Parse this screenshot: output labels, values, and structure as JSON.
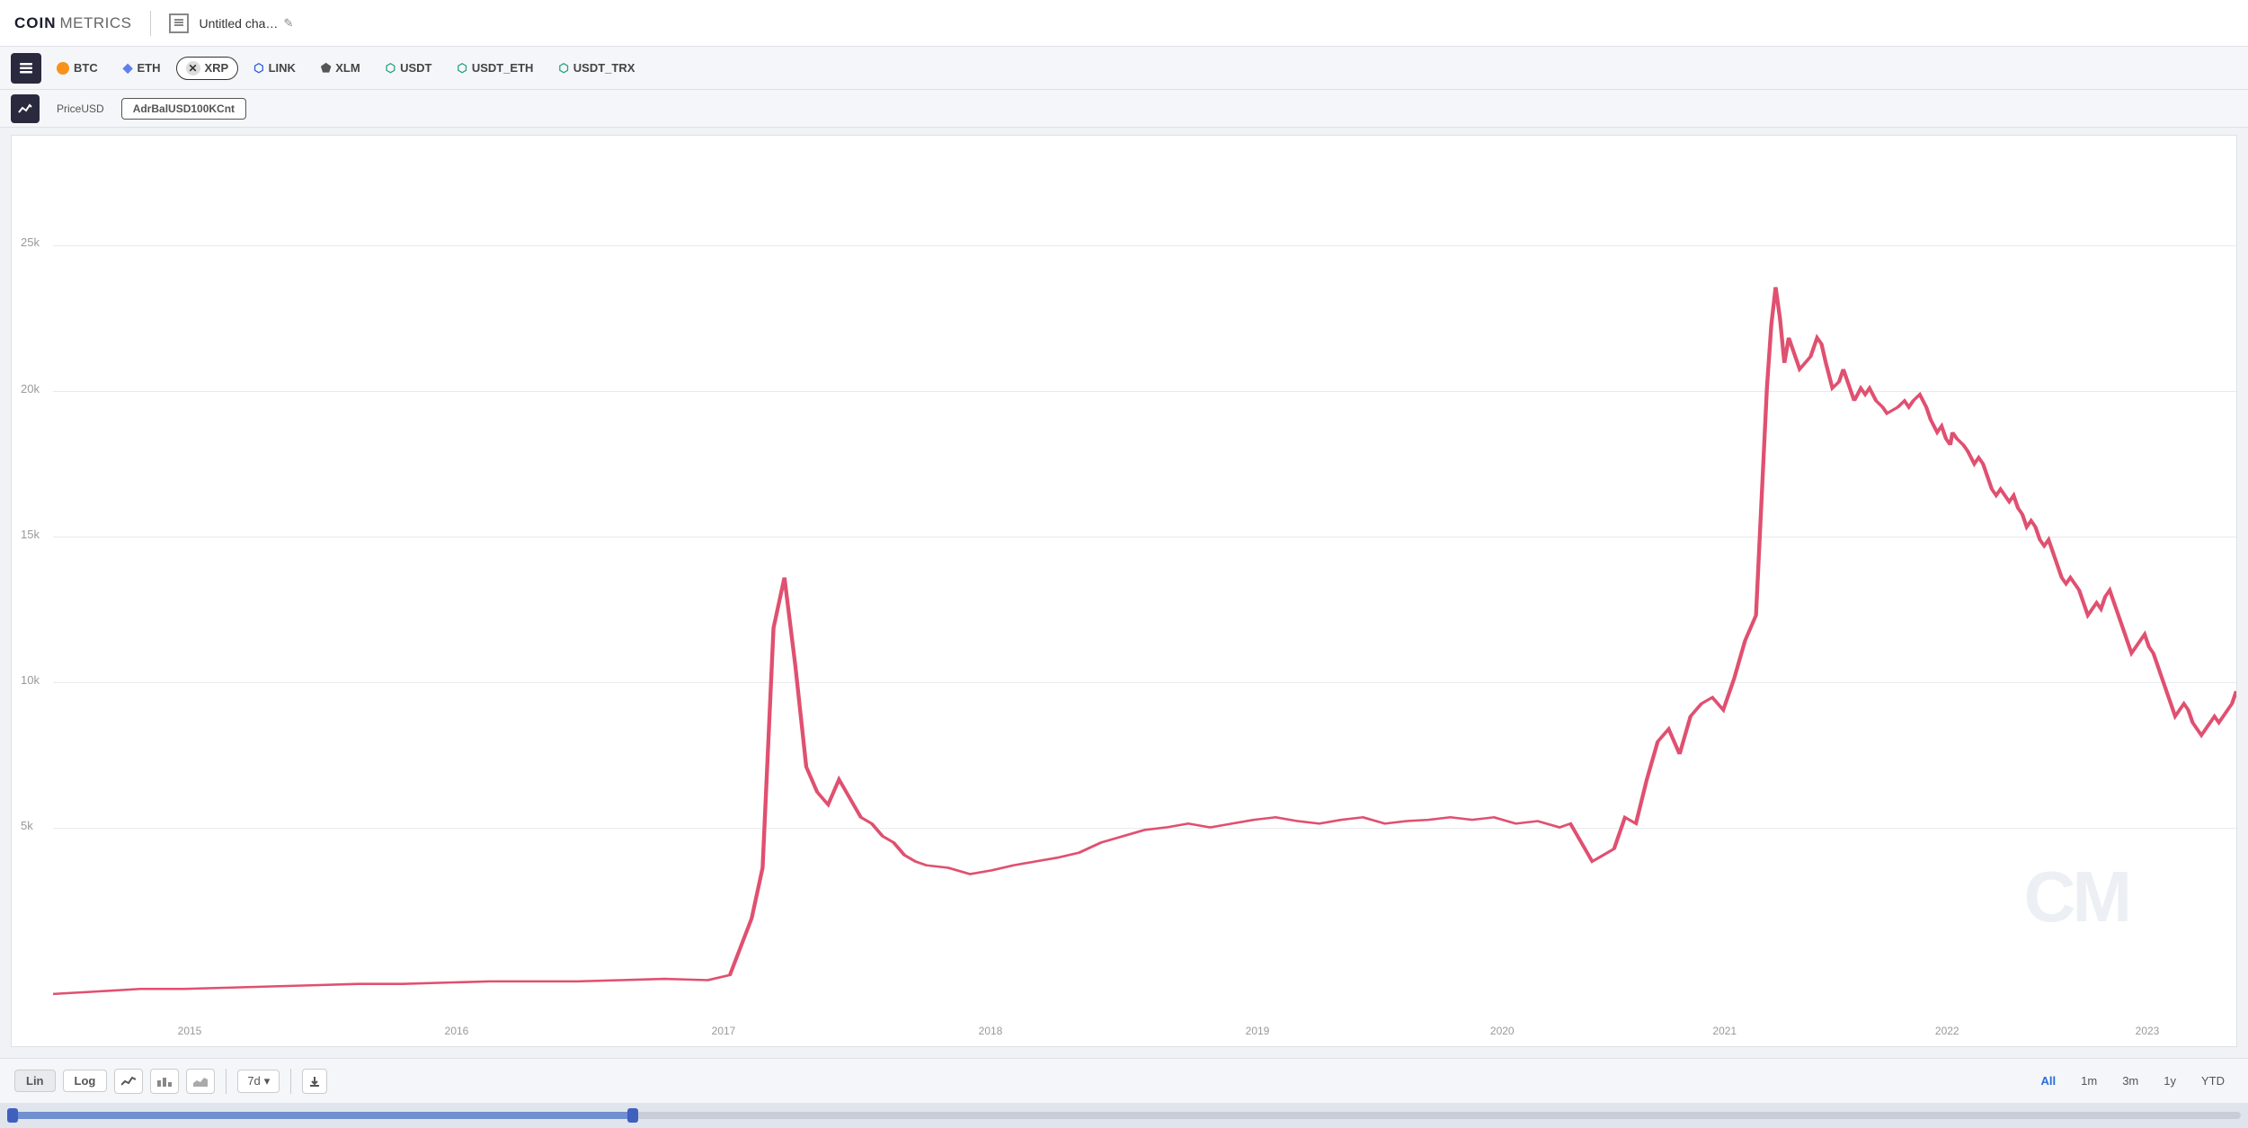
{
  "header": {
    "logo_coin": "COIN",
    "logo_metrics": "METRICS",
    "chart_title": "Untitled cha…",
    "edit_label": "✎"
  },
  "toolbar": {
    "coins": [
      {
        "id": "BTC",
        "label": "BTC",
        "color": "#f7931a",
        "type": "circle",
        "active": false
      },
      {
        "id": "ETH",
        "label": "ETH",
        "color": "#627eea",
        "type": "circle",
        "active": false
      },
      {
        "id": "XRP",
        "label": "XRP",
        "color": "#333",
        "type": "x",
        "active": true
      },
      {
        "id": "LINK",
        "label": "LINK",
        "color": "#2a5ada",
        "type": "circle",
        "active": false
      },
      {
        "id": "XLM",
        "label": "XLM",
        "color": "#666",
        "type": "shield",
        "active": false
      },
      {
        "id": "USDT",
        "label": "USDT",
        "color": "#26a17b",
        "type": "shield",
        "active": false
      },
      {
        "id": "USDT_ETH",
        "label": "USDT_ETH",
        "color": "#26a17b",
        "type": "shield",
        "active": false
      },
      {
        "id": "USDT_TRX",
        "label": "USDT_TRX",
        "color": "#26a17b",
        "type": "shield",
        "active": false
      }
    ]
  },
  "metric_toolbar": {
    "metrics": [
      {
        "id": "PriceUSD",
        "label": "PriceUSD",
        "active": false
      },
      {
        "id": "AdrBalUSD100KCnt",
        "label": "AdrBalUSD100KCnt",
        "active": true
      }
    ]
  },
  "chart": {
    "y_labels": [
      "25k",
      "20k",
      "15k",
      "10k",
      "5k"
    ],
    "x_labels": [
      "2015",
      "2016",
      "2017",
      "2018",
      "2019",
      "2020",
      "2021",
      "2022",
      "2023"
    ],
    "watermark": "CM",
    "line_color": "#e05070"
  },
  "bottom_controls": {
    "scale_lin": "Lin",
    "scale_log": "Log",
    "interval": "7d",
    "ranges": [
      "All",
      "1m",
      "3m",
      "1y",
      "YTD"
    ],
    "active_range": "All"
  }
}
